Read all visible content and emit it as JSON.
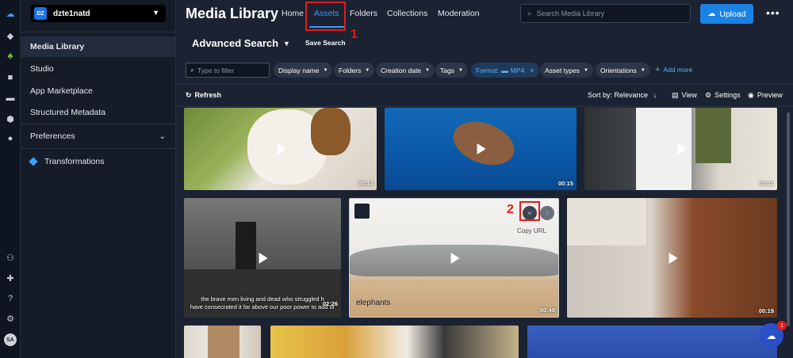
{
  "account": {
    "badge": "DZ",
    "name": "dzte1natd"
  },
  "rail_icons": [
    "cloud-icon",
    "diamond-icon",
    "apps-icon",
    "video-icon",
    "chat-icon",
    "hexagon-icon",
    "bubble-icon",
    "add-user-icon",
    "puzzle-icon",
    "help-icon",
    "gear-icon"
  ],
  "avatar": "SA",
  "sidebar": {
    "items": [
      {
        "label": "Media Library",
        "active": true
      },
      {
        "label": "Studio"
      },
      {
        "label": "App Marketplace"
      },
      {
        "label": "Structured Metadata"
      },
      {
        "label": "Preferences"
      },
      {
        "label": "Transformations"
      }
    ]
  },
  "header": {
    "title": "Media Library",
    "tabs": [
      "Home",
      "Assets",
      "Folders",
      "Collections",
      "Moderation"
    ],
    "active_tab": "Assets",
    "search_placeholder": "Search Media Library",
    "upload_label": "Upload",
    "more_label": "•••"
  },
  "annotations": {
    "one": "1",
    "two": "2"
  },
  "advanced": {
    "label": "Advanced Search",
    "save_label": "Save Search"
  },
  "filters": {
    "placeholder": "Type to filter",
    "chips": [
      "Display name",
      "Folders",
      "Creation date",
      "Tags"
    ],
    "format_chip": "Format:",
    "format_value": "MP4",
    "chips2": [
      "Asset types",
      "Orientations"
    ],
    "add_more": "Add more"
  },
  "toolbar": {
    "refresh": "Refresh",
    "sort": "Sort by: Relevance",
    "view": "View",
    "settings": "Settings",
    "preview": "Preview"
  },
  "assets": [
    {
      "duration": "00:13"
    },
    {
      "duration": "00:15"
    },
    {
      "duration": "00:11"
    },
    {
      "duration": "02:26",
      "caption1": "the brave men living and dead who struggled h",
      "caption2": "have consecrated it far above our poor power to add or"
    },
    {
      "duration": "00:48",
      "name": "elephants",
      "copy_url": "Copy URL"
    },
    {
      "duration": "00:19"
    }
  ],
  "help_count": "1",
  "colors": {
    "accent": "#3a9cff",
    "upload": "#1a82e2",
    "annotation": "#e21b1b"
  }
}
